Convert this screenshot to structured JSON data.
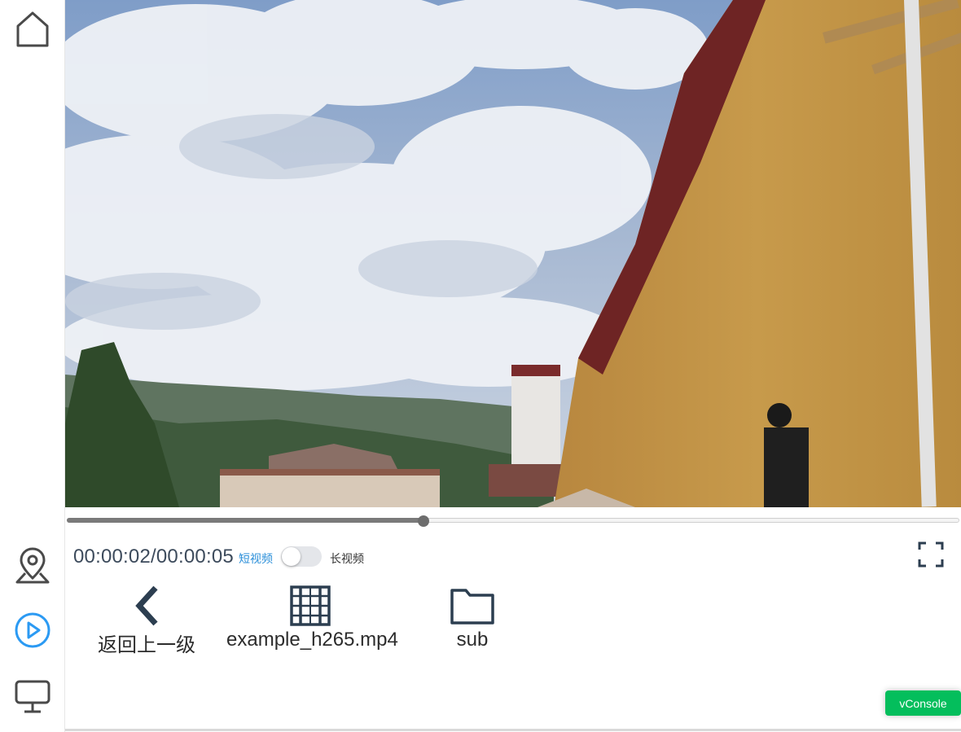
{
  "sidebar": {
    "items": [
      {
        "icon": "home-icon"
      },
      {
        "icon": "location-icon"
      },
      {
        "icon": "play-icon",
        "active": true
      },
      {
        "icon": "monitor-icon"
      }
    ],
    "active_color": "#2b9af3",
    "inactive_color": "#4a4a4a"
  },
  "player": {
    "progress_fraction": 0.4,
    "time_display": "00:00:02/00:00:05",
    "short_video_label": "短视频",
    "long_video_label": "长视频",
    "toggle_on": false
  },
  "files": [
    {
      "icon": "chevron-left-icon",
      "label": "返回上一级"
    },
    {
      "icon": "video-file-icon",
      "label": "example_h265.mp4"
    },
    {
      "icon": "folder-icon",
      "label": "sub"
    }
  ],
  "vconsole": {
    "label": "vConsole",
    "color": "#04be5c"
  }
}
